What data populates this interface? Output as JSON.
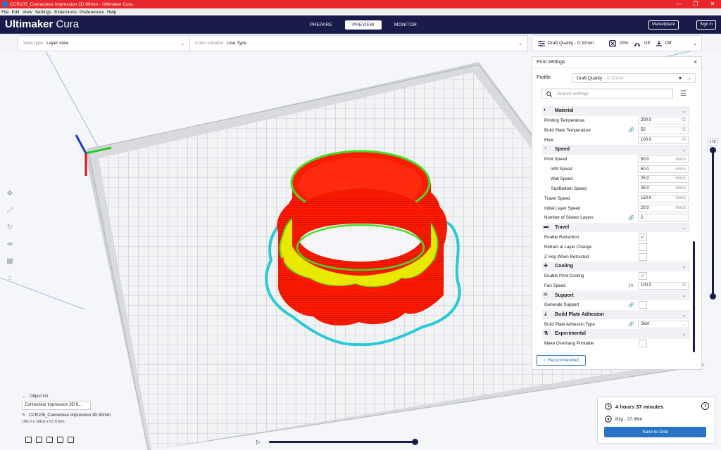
{
  "window": {
    "title": "CCR105_Connecteur impression 3D 80mm - Ultimaker Cura",
    "controls": [
      "—",
      "❐",
      "✕"
    ]
  },
  "menu": [
    "File",
    "Edit",
    "View",
    "Settings",
    "Extensions",
    "Preferences",
    "Help"
  ],
  "header": {
    "logo_bold": "Ultimaker",
    "logo_rest": " Cura",
    "stages": [
      "PREPARE",
      "PREVIEW",
      "MONITOR"
    ],
    "active_stage": "PREVIEW",
    "marketplace": "Marketplace",
    "signin": "Sign in"
  },
  "view_toolbar": {
    "view_type_label": "View type",
    "view_type_value": "Layer view",
    "color_scheme_label": "Color scheme",
    "color_scheme_value": "Line Type"
  },
  "print_toolbar": {
    "quality": "Draft Quality - 0.32mm",
    "infill": "20%",
    "support": "Off",
    "adhesion": "Off"
  },
  "print_settings": {
    "title": "Print settings",
    "close": "×",
    "profile_label": "Profile",
    "profile_value": "Draft Quality",
    "profile_sub": "- 0.32mm",
    "search_placeholder": "Search settings",
    "recommended": "Recommended",
    "rows": [
      {
        "kind": "cat",
        "label": "Material",
        "icon": "material-icon"
      },
      {
        "kind": "val",
        "label": "Printing Temperature",
        "value": "200.0",
        "unit": "°C"
      },
      {
        "kind": "val",
        "label": "Build Plate Temperature",
        "value": "50",
        "unit": "°C",
        "link": true
      },
      {
        "kind": "val",
        "label": "Flow",
        "value": "100.0",
        "unit": "%"
      },
      {
        "kind": "cat",
        "label": "Speed",
        "icon": "speed-icon"
      },
      {
        "kind": "val",
        "label": "Print Speed",
        "value": "50.0",
        "unit": "mm/s"
      },
      {
        "kind": "val",
        "label": "Infill Speed",
        "value": "50.0",
        "unit": "mm/s",
        "sub": true
      },
      {
        "kind": "val",
        "label": "Wall Speed",
        "value": "25.0",
        "unit": "mm/s",
        "sub": true
      },
      {
        "kind": "val",
        "label": "Top/Bottom Speed",
        "value": "25.0",
        "unit": "mm/s",
        "sub": true
      },
      {
        "kind": "val",
        "label": "Travel Speed",
        "value": "150.0",
        "unit": "mm/s"
      },
      {
        "kind": "val",
        "label": "Initial Layer Speed",
        "value": "20.0",
        "unit": "mm/s"
      },
      {
        "kind": "val",
        "label": "Number of Slower Layers",
        "value": "2",
        "unit": "",
        "link": true
      },
      {
        "kind": "cat",
        "label": "Travel",
        "icon": "travel-icon"
      },
      {
        "kind": "chk",
        "label": "Enable Retraction",
        "checked": true
      },
      {
        "kind": "chk",
        "label": "Retract at Layer Change",
        "checked": false
      },
      {
        "kind": "chk",
        "label": "Z Hop When Retracted",
        "checked": false
      },
      {
        "kind": "cat",
        "label": "Cooling",
        "icon": "fan-icon"
      },
      {
        "kind": "chk",
        "label": "Enable Print Cooling",
        "checked": true
      },
      {
        "kind": "val",
        "label": "Fan Speed",
        "value": "100.0",
        "unit": "%",
        "fx": true
      },
      {
        "kind": "cat",
        "label": "Support",
        "icon": "support-icon"
      },
      {
        "kind": "chk",
        "label": "Generate Support",
        "checked": false,
        "link": true
      },
      {
        "kind": "cat",
        "label": "Build Plate Adhesion",
        "icon": "adhesion-icon"
      },
      {
        "kind": "sel",
        "label": "Build Plate Adhesion Type",
        "value": "Skirt",
        "link": true
      },
      {
        "kind": "cat",
        "label": "Experimental",
        "icon": "flask-icon"
      },
      {
        "kind": "chk",
        "label": "Make Overhang Printable",
        "checked": false
      }
    ]
  },
  "layer_slider": {
    "value": "178"
  },
  "object_list": {
    "title": "Object list",
    "item": "Connecteur impression 3D 8...",
    "name": "CCR105_Connecteur impression 3D 80mm",
    "dims": "106.0 x 106.0 x 57.0 mm"
  },
  "estimate": {
    "time": "4 hours 37 minutes",
    "material": "81g · 27.06m",
    "save": "Save to Disk"
  },
  "colors": {
    "header": "#191c4a",
    "accent": "#2a74c7",
    "titlebar": "#e8262b",
    "model": "#ff1a00",
    "infill": "#e8e800",
    "skirt": "#29c9d6",
    "wall_inner": "#44dd22"
  }
}
